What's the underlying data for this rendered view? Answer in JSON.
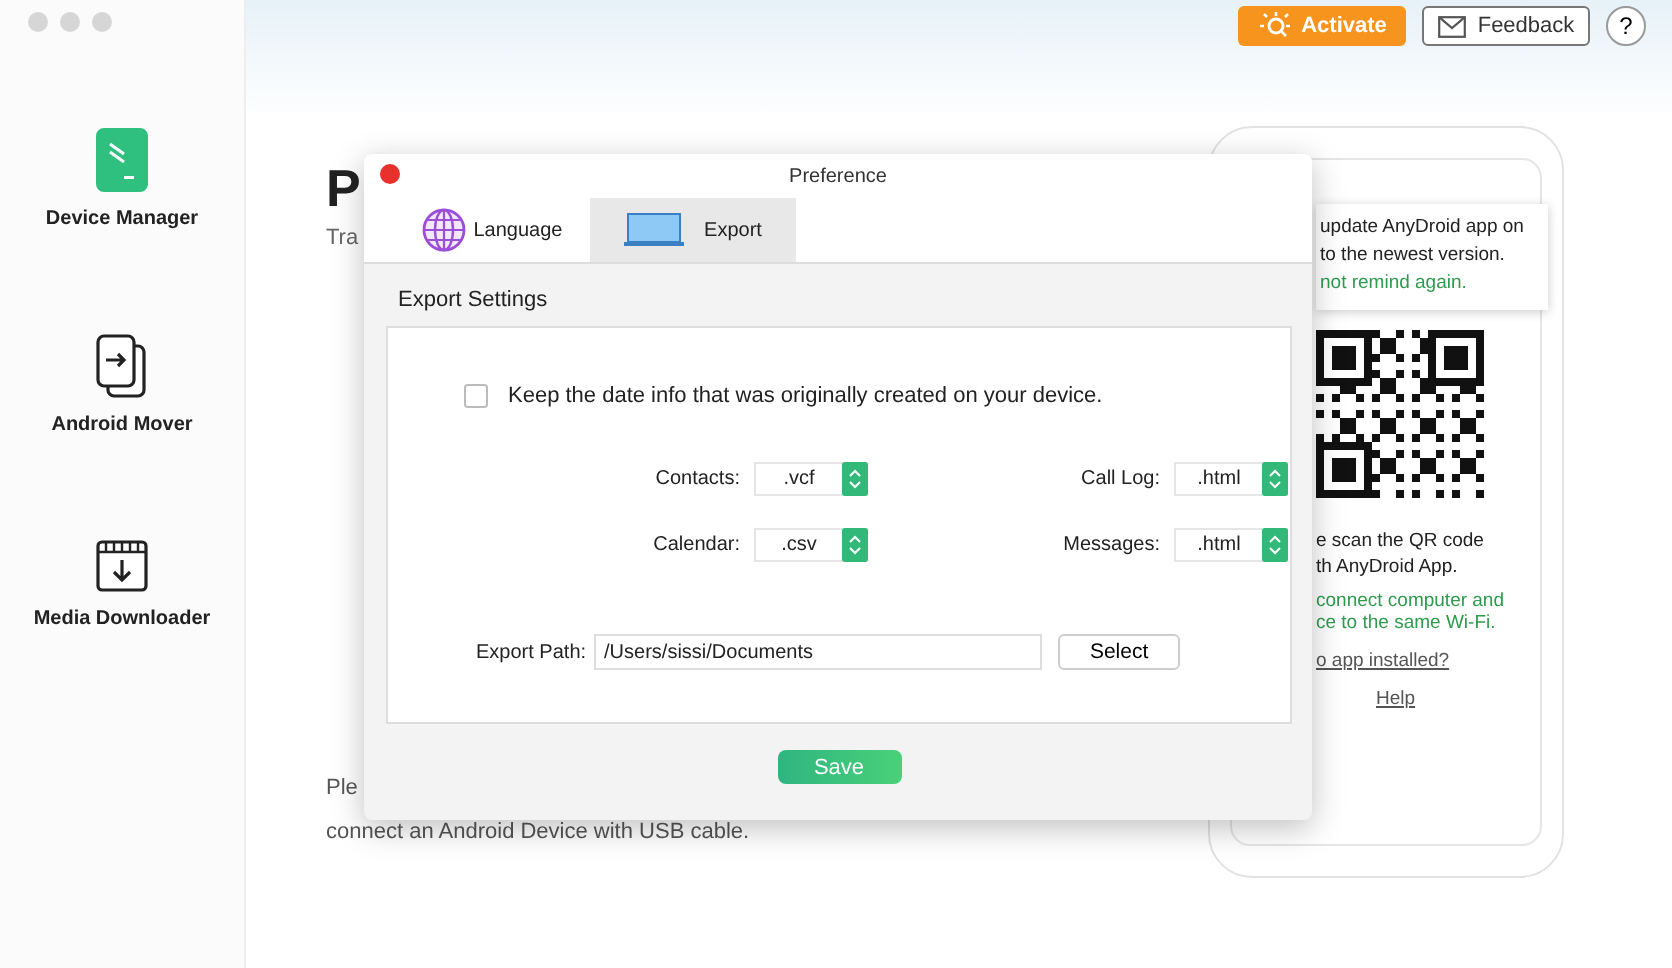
{
  "sidebar": {
    "items": [
      {
        "label": "Device Manager",
        "kind": "phone",
        "selected": true
      },
      {
        "label": "Android Mover",
        "kind": "mover",
        "selected": false
      },
      {
        "label": "Media Downloader",
        "kind": "download",
        "selected": false
      }
    ]
  },
  "topbar": {
    "activate": "Activate",
    "feedback": "Feedback",
    "help": "?"
  },
  "background": {
    "title": "P",
    "subtitle": "Tra",
    "hint": "Ple",
    "hint_2": "connect an Android Device with USB cable."
  },
  "phone": {
    "tooltip_lines": [
      "update AnyDroid app on",
      "to the newest version."
    ],
    "tooltip_link": "not remind again.",
    "scan_lines": [
      "e scan the QR code",
      "th AnyDroid App."
    ],
    "wifi_lines": [
      "connect computer and",
      "ce to the same Wi-Fi."
    ],
    "no_app_link": "o app installed?",
    "help_link": "Help"
  },
  "dialog": {
    "title": "Preference",
    "tabs": [
      {
        "label": "Language",
        "kind": "globe",
        "selected": false
      },
      {
        "label": "Export",
        "kind": "laptop",
        "selected": true
      }
    ],
    "section_title": "Export Settings",
    "keep_date": {
      "label": "Keep the date info that was originally created on your device.",
      "checked": false
    },
    "formats": [
      {
        "label": "Contacts:",
        "value": ".vcf"
      },
      {
        "label": "Call Log:",
        "value": ".html"
      },
      {
        "label": "Calendar:",
        "value": ".csv"
      },
      {
        "label": "Messages:",
        "value": ".html"
      }
    ],
    "export_path": {
      "label": "Export Path:",
      "value": "/Users/sissi/Documents"
    },
    "select_button": "Select",
    "save_button": "Save"
  }
}
